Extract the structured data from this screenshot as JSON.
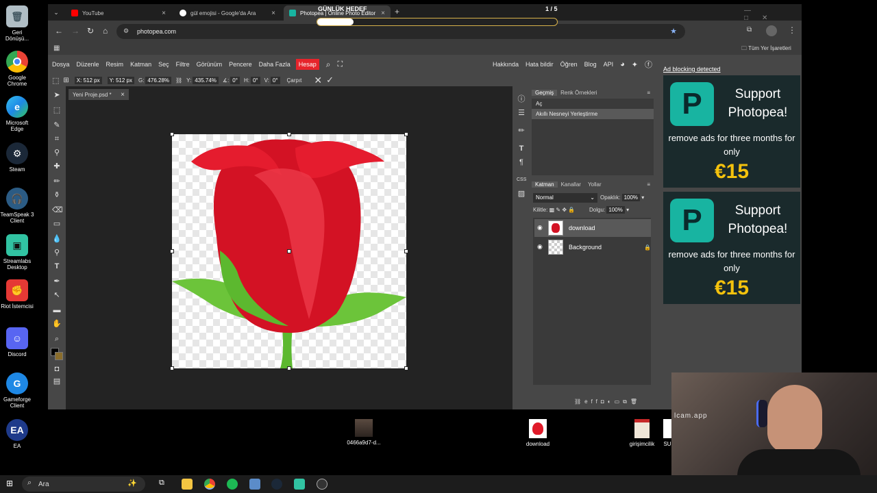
{
  "desktop": {
    "icons": [
      {
        "label": "Geri Dönüşü...",
        "icon": "recycle-bin-icon",
        "color": "#cfd8dc"
      },
      {
        "label": "Google Chrome",
        "icon": "chrome-icon",
        "color": "#4caf50"
      },
      {
        "label": "Microsoft Edge",
        "icon": "edge-icon",
        "color": "#1e88e5"
      },
      {
        "label": "Steam",
        "icon": "steam-icon",
        "color": "#1b2838"
      },
      {
        "label": "TeamSpeak 3 Client",
        "icon": "teamspeak-icon",
        "color": "#2b5b84"
      },
      {
        "label": "Streamlabs Desktop",
        "icon": "streamlabs-icon",
        "color": "#31c3a2"
      },
      {
        "label": "Riot İstemcisi",
        "icon": "riot-icon",
        "color": "#e53935"
      },
      {
        "label": "Discord",
        "icon": "discord-icon",
        "color": "#5865f2"
      },
      {
        "label": "Gameforge Client",
        "icon": "gameforge-icon",
        "color": "#1e88e5"
      },
      {
        "label": "EA",
        "icon": "ea-icon",
        "color": "#1e3a8a"
      }
    ],
    "files": [
      {
        "label": "0466a9d7-d..."
      },
      {
        "label": "download"
      },
      {
        "label": "girişimcilik"
      },
      {
        "label": "SU"
      }
    ]
  },
  "overlay": {
    "title": "GÜNLÜK HEDEF",
    "counter": "1 / 5",
    "progress": 0.15
  },
  "browser": {
    "tabs": [
      {
        "label": "YouTube",
        "color": "#ff0000"
      },
      {
        "label": "gül emojisi - Google'da Ara",
        "color": "#4285f4"
      },
      {
        "label": "Photopea | Online Photo Editor",
        "color": "#18b4a1"
      }
    ],
    "new_tab": "+",
    "url": "photopea.com",
    "bookmarks_all": "Tüm Yer İşaretleri"
  },
  "photopea": {
    "menu": [
      "Dosya",
      "Düzenle",
      "Resim",
      "Katman",
      "Seç",
      "Filtre",
      "Görünüm",
      "Pencere",
      "Daha Fazla"
    ],
    "account": "Hesap",
    "right_links": [
      "Hakkında",
      "Hata bildir",
      "Öğren",
      "Blog",
      "API"
    ],
    "options": {
      "x": "X: 512 px",
      "y": "Y: 512 px",
      "w_label": "G:",
      "w": "476.28%",
      "h_label": "Y:",
      "h": "435.74%",
      "angle_label": "∡:",
      "angle": "0°",
      "hskew_label": "H:",
      "hskew": "0°",
      "vskew_label": "V:",
      "vskew": "0°",
      "warp": "Çarpıt"
    },
    "doc_tab": "Yeni Proje.psd *",
    "history": {
      "tabs": [
        "Geçmiş",
        "Renk Örnekleri"
      ],
      "items": [
        "Aç",
        "Akıllı Nesneyi Yerleştirme"
      ]
    },
    "layers": {
      "tabs": [
        "Katman",
        "Kanallar",
        "Yollar"
      ],
      "blend": "Normal",
      "opacity_label": "Opaklık:",
      "opacity": "100%",
      "lock_label": "Kilitle:",
      "fill_label": "Dolgu:",
      "fill": "100%",
      "list": [
        {
          "name": "download"
        },
        {
          "name": "Background"
        }
      ],
      "footer": "eff"
    },
    "ads": {
      "notice": "Ad blocking detected",
      "title": "Support Photopea!",
      "text": "remove ads for three months for only",
      "price": "€15"
    }
  },
  "taskbar": {
    "search_placeholder": "Ara"
  },
  "webcam": {
    "watermark": "lcam.app"
  }
}
